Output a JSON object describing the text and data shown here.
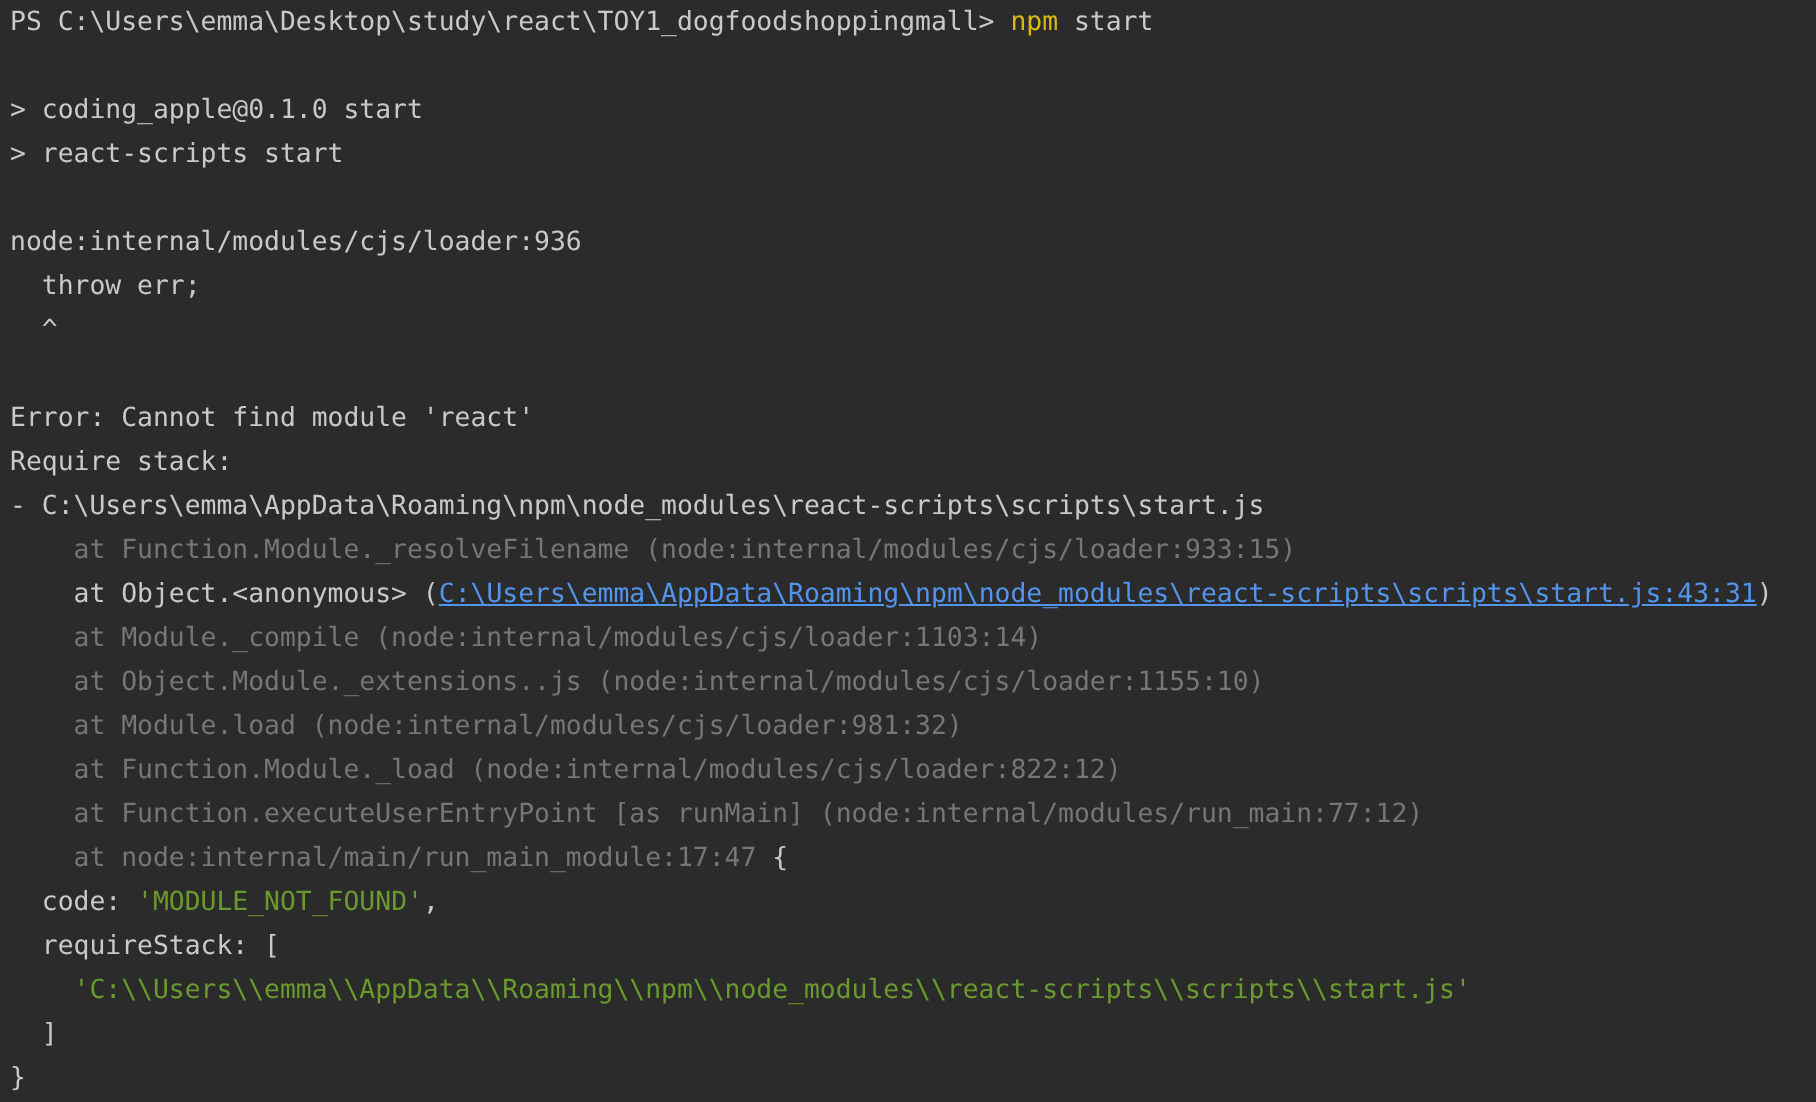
{
  "terminal": {
    "lines": [
      {
        "kind": "text",
        "segments": [
          {
            "kind": "plain",
            "text": "PS C:\\Users\\emma\\Desktop\\study\\react\\TOY1_dogfoodshoppingmall> "
          },
          {
            "kind": "command",
            "text": "npm"
          },
          {
            "kind": "plain",
            "text": " start"
          }
        ]
      },
      {
        "kind": "blank"
      },
      {
        "kind": "text",
        "segments": [
          {
            "kind": "plain",
            "text": "> coding_apple@0.1.0 start"
          }
        ]
      },
      {
        "kind": "text",
        "segments": [
          {
            "kind": "plain",
            "text": "> react-scripts start"
          }
        ]
      },
      {
        "kind": "blank"
      },
      {
        "kind": "text",
        "segments": [
          {
            "kind": "plain",
            "text": "node:internal/modules/cjs/loader:936"
          }
        ]
      },
      {
        "kind": "text",
        "segments": [
          {
            "kind": "plain",
            "text": "  throw err;"
          }
        ]
      },
      {
        "kind": "text",
        "segments": [
          {
            "kind": "plain",
            "text": "  ^"
          }
        ]
      },
      {
        "kind": "blank"
      },
      {
        "kind": "text",
        "segments": [
          {
            "kind": "plain",
            "text": "Error: Cannot find module 'react'"
          }
        ]
      },
      {
        "kind": "text",
        "segments": [
          {
            "kind": "plain",
            "text": "Require stack:"
          }
        ]
      },
      {
        "kind": "text",
        "segments": [
          {
            "kind": "plain",
            "text": "- C:\\Users\\emma\\AppData\\Roaming\\npm\\node_modules\\react-scripts\\scripts\\start.js"
          }
        ]
      },
      {
        "kind": "text",
        "segments": [
          {
            "kind": "dim",
            "text": "    at Function.Module._resolveFilename (node:internal/modules/cjs/loader:933:15)"
          }
        ]
      },
      {
        "kind": "text",
        "segments": [
          {
            "kind": "plain",
            "text": "    at Object.<anonymous> ("
          },
          {
            "kind": "link",
            "text": "C:\\Users\\emma\\AppData\\Roaming\\npm\\node_modules\\react-scripts\\scripts\\start.js:43:31"
          },
          {
            "kind": "plain",
            "text": ")"
          }
        ]
      },
      {
        "kind": "text",
        "segments": [
          {
            "kind": "dim",
            "text": "    at Module._compile (node:internal/modules/cjs/loader:1103:14)"
          }
        ]
      },
      {
        "kind": "text",
        "segments": [
          {
            "kind": "dim",
            "text": "    at Object.Module._extensions..js (node:internal/modules/cjs/loader:1155:10)"
          }
        ]
      },
      {
        "kind": "text",
        "segments": [
          {
            "kind": "dim",
            "text": "    at Module.load (node:internal/modules/cjs/loader:981:32)"
          }
        ]
      },
      {
        "kind": "text",
        "segments": [
          {
            "kind": "dim",
            "text": "    at Function.Module._load (node:internal/modules/cjs/loader:822:12)"
          }
        ]
      },
      {
        "kind": "text",
        "segments": [
          {
            "kind": "dim",
            "text": "    at Function.executeUserEntryPoint [as runMain] (node:internal/modules/run_main:77:12)"
          }
        ]
      },
      {
        "kind": "text",
        "segments": [
          {
            "kind": "dim",
            "text": "    at node:internal/main/run_main_module:17:47"
          },
          {
            "kind": "plain",
            "text": " {"
          }
        ]
      },
      {
        "kind": "text",
        "segments": [
          {
            "kind": "plain",
            "text": "  code: "
          },
          {
            "kind": "string",
            "text": "'MODULE_NOT_FOUND'"
          },
          {
            "kind": "plain",
            "text": ","
          }
        ]
      },
      {
        "kind": "text",
        "segments": [
          {
            "kind": "plain",
            "text": "  requireStack: ["
          }
        ]
      },
      {
        "kind": "text",
        "segments": [
          {
            "kind": "string",
            "text": "    'C:\\\\Users\\\\emma\\\\AppData\\\\Roaming\\\\npm\\\\node_modules\\\\react-scripts\\\\scripts\\\\start.js'"
          }
        ]
      },
      {
        "kind": "text",
        "segments": [
          {
            "kind": "plain",
            "text": "  ]"
          }
        ]
      },
      {
        "kind": "text",
        "segments": [
          {
            "kind": "plain",
            "text": "}"
          }
        ]
      }
    ]
  }
}
